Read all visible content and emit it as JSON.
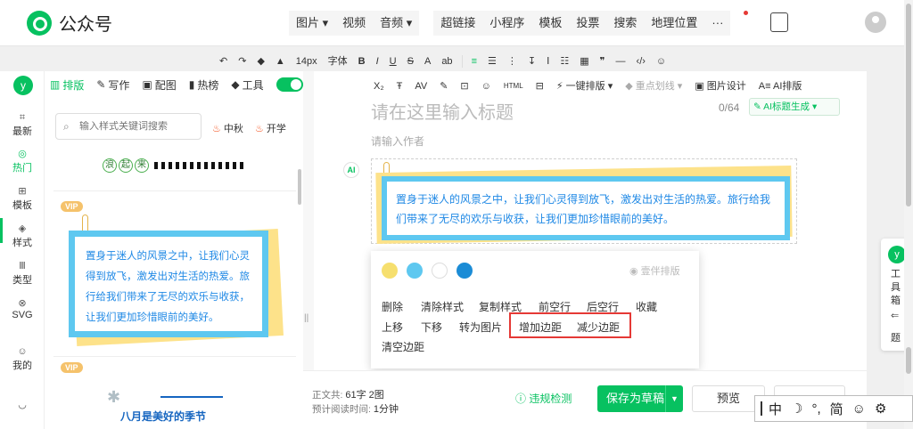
{
  "app": {
    "name": "公众号"
  },
  "top_nav": [
    "图片",
    "视频",
    "音频",
    "超链接",
    "小程序",
    "模板",
    "投票",
    "搜索",
    "地理位置",
    "···"
  ],
  "toolbar1": [
    "↶",
    "↷",
    "◆",
    "▲",
    "14px",
    "字体",
    "B",
    "I",
    "U",
    "S",
    "A",
    "ab",
    "≡",
    "☰",
    "⋮",
    "↧",
    "Ⅰ",
    "☷",
    "▦",
    "❞",
    "—",
    "‹/›",
    "☺"
  ],
  "toolbar2": [
    "X₂",
    "Ŧ",
    "AV",
    "✎",
    "⊡",
    "☺",
    "HTML",
    "⊟",
    "一键排版",
    "重点划线",
    "图片设计",
    "AI排版"
  ],
  "left_nav": [
    {
      "icon": "⌗",
      "label": "最新"
    },
    {
      "icon": "◎",
      "label": "热门"
    },
    {
      "icon": "⊞",
      "label": "模板"
    },
    {
      "icon": "◈",
      "label": "样式"
    },
    {
      "icon": "Ⅲ",
      "label": "类型"
    },
    {
      "icon": "⊗",
      "label": "SVG"
    },
    {
      "icon": "☺",
      "label": "我的"
    },
    {
      "icon": "◡",
      "label": ""
    }
  ],
  "panel": {
    "tabs": [
      {
        "icon": "▥",
        "label": "排版"
      },
      {
        "icon": "✎",
        "label": "写作"
      },
      {
        "icon": "▣",
        "label": "配图"
      },
      {
        "icon": "▮",
        "label": "热榜"
      },
      {
        "icon": "◆",
        "label": "工具"
      }
    ],
    "search_placeholder": "输入样式关键词搜索",
    "hot_tags": [
      "中秋",
      "开学"
    ],
    "tpl1_bubbles": [
      "浪",
      "起",
      "来"
    ],
    "vip_label": "VIP",
    "card_text": "置身于迷人的风景之中，让我们心灵得到放飞，激发出对生活的热爱。旅行给我们带来了无尽的欢乐与收获，让我们更加珍惜眼前的美好。",
    "tpl3_caption": "八月是美好的季节"
  },
  "editor": {
    "title_placeholder": "请在这里输入标题",
    "title_count": "0/64",
    "ai_title_button": "AI标题生成",
    "author_placeholder": "请输入作者",
    "card_text": "置身于迷人的风景之中，让我们心灵得到放飞，激发出对生活的热爱。旅行给我们带来了无尽的欢乐与收获，让我们更加珍惜眼前的美好。"
  },
  "popup": {
    "swatches": [
      "#f6df6e",
      "#5ec8f0",
      "#ffffff",
      "#1b8cd6"
    ],
    "one_click": "壹伴排版",
    "row1": [
      "删除",
      "清除样式",
      "复制样式",
      "前空行",
      "后空行",
      "收藏"
    ],
    "row2": [
      "上移",
      "下移",
      "转为图片",
      "增加边距",
      "减少边距"
    ],
    "row3": [
      "清空边距"
    ]
  },
  "status": {
    "body_label": "正文共:",
    "body_value": "61字 2图",
    "read_label": "预计阅读时间:",
    "read_value": "1分钟",
    "violation": "违规检测",
    "save": "保存为草稿",
    "preview": "预览"
  },
  "toolbox": {
    "label": "工具箱",
    "extra": "题"
  },
  "ime": [
    "中",
    "☽",
    "°,",
    "简",
    "☺",
    "⚙"
  ],
  "colors": {
    "brand": "#07c160",
    "highlight": "#e53935",
    "card_border": "#5ec8f0",
    "card_text": "#1e88e5"
  }
}
